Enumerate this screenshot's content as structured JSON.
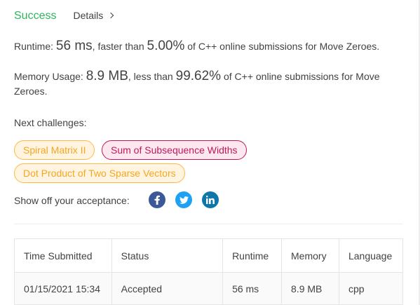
{
  "header": {
    "status": "Success",
    "details_label": "Details"
  },
  "runtime": {
    "label": "Runtime:",
    "value": "56 ms",
    "comparison": ", faster than",
    "percent": "5.00%",
    "suffix": "of C++ online submissions for Move Zeroes."
  },
  "memory": {
    "label": "Memory Usage:",
    "value": "8.9 MB",
    "comparison": ", less than",
    "percent": "99.62%",
    "suffix": "of C++ online submissions for Move Zeroes."
  },
  "next": {
    "label": "Next challenges:",
    "challenges": [
      {
        "title": "Spiral Matrix II",
        "difficulty_color": "#f5a623"
      },
      {
        "title": "Sum of Subsequence Widths",
        "difficulty_color": "#c2185b"
      },
      {
        "title": "Dot Product of Two Sparse Vectors",
        "difficulty_color": "#f5a623"
      }
    ]
  },
  "share": {
    "label": "Show off your acceptance:",
    "icons": [
      "facebook-icon",
      "twitter-icon",
      "linkedin-icon"
    ]
  },
  "table": {
    "headers": [
      "Time Submitted",
      "Status",
      "Runtime",
      "Memory",
      "Language"
    ],
    "rows": [
      [
        "01/15/2021 15:34",
        "Accepted",
        "56 ms",
        "8.9 MB",
        "cpp"
      ]
    ]
  },
  "colors": {
    "success": "#2db55d",
    "medium": "#f5a623",
    "hard": "#c2185b"
  }
}
